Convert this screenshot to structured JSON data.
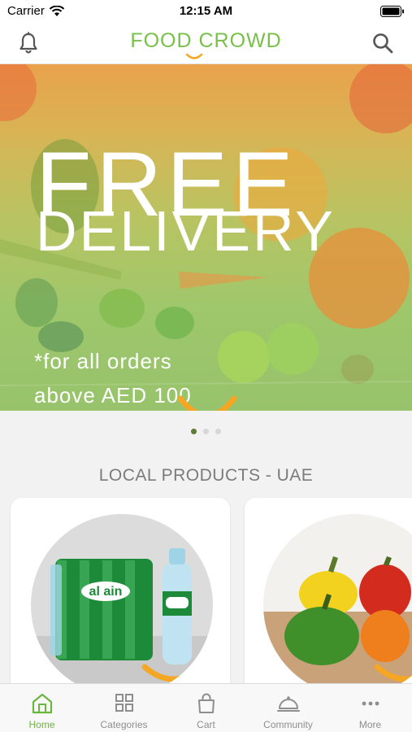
{
  "status_bar": {
    "carrier": "Carrier",
    "time": "12:15 AM"
  },
  "header": {
    "logo_text": "FOOD CROWD",
    "brand_color": "#77c14a",
    "accent_color": "#f5a623"
  },
  "banner": {
    "headline_line1": "FREE",
    "headline_line2": "DELIVERY",
    "note_line1": "*for all orders",
    "note_line2": "above AED 100"
  },
  "carousel": {
    "total_pages": 3,
    "active_page": 1
  },
  "section": {
    "title": "LOCAL PRODUCTS - UAE"
  },
  "products": [
    {
      "image": "al-ain-water-pack-photo",
      "brand_text": "al ain"
    },
    {
      "image": "bell-peppers-photo"
    }
  ],
  "tabbar": {
    "items": [
      {
        "label": "Home",
        "icon": "home-icon",
        "active": true
      },
      {
        "label": "Categories",
        "icon": "grid-icon",
        "active": false
      },
      {
        "label": "Cart",
        "icon": "bag-icon",
        "active": false
      },
      {
        "label": "Community",
        "icon": "cloche-icon",
        "active": false
      },
      {
        "label": "More",
        "icon": "more-dots-icon",
        "active": false
      }
    ]
  }
}
